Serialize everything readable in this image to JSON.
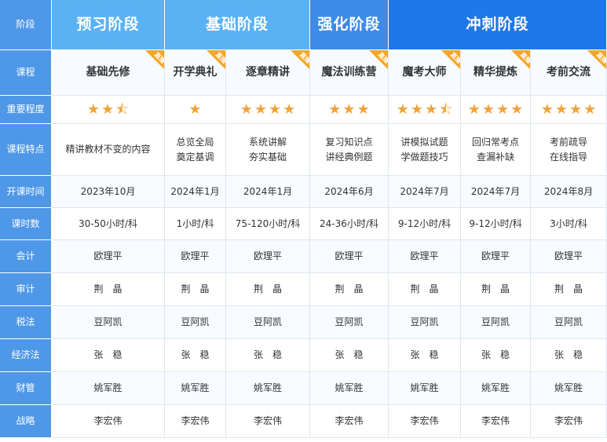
{
  "labels": [
    "阶段",
    "课程",
    "重要程度",
    "课程特点",
    "开课时间",
    "课时数",
    "会计",
    "审计",
    "税法",
    "经济法",
    "财管",
    "战略"
  ],
  "stages": [
    {
      "name": "预习阶段",
      "span": 1,
      "tone": "h-light"
    },
    {
      "name": "基础阶段",
      "span": 2,
      "tone": "h-light"
    },
    {
      "name": "强化阶段",
      "span": 1,
      "tone": "h-mid"
    },
    {
      "name": "冲刺阶段",
      "span": 3,
      "tone": "h-dark"
    }
  ],
  "tag_text": "直播",
  "courses": [
    {
      "name": "基础先修",
      "stars": 2.5,
      "feature": "精讲教材不变的内容",
      "start": "2023年10月",
      "hours": "30-50小时/科",
      "kuaiji": "欧理平",
      "shenji": "荆　晶",
      "shuifa": "豆阿凯",
      "jingjifa": "张　稳",
      "caiguan": "姚军胜",
      "zhanlue": "李宏伟"
    },
    {
      "name": "开学典礼",
      "stars": 1,
      "feature": "总览全局\n奠定基调",
      "start": "2024年1月",
      "hours": "1小时/科",
      "kuaiji": "欧理平",
      "shenji": "荆　晶",
      "shuifa": "豆阿凯",
      "jingjifa": "张　稳",
      "caiguan": "姚军胜",
      "zhanlue": "李宏伟"
    },
    {
      "name": "逐章精讲",
      "stars": 4,
      "feature": "系统讲解\n夯实基础",
      "start": "2024年1月",
      "hours": "75-120小时/科",
      "kuaiji": "欧理平",
      "shenji": "荆　晶",
      "shuifa": "豆阿凯",
      "jingjifa": "张　稳",
      "caiguan": "姚军胜",
      "zhanlue": "李宏伟"
    },
    {
      "name": "魔法训练营",
      "stars": 3,
      "feature": "复习知识点\n讲经典例题",
      "start": "2024年6月",
      "hours": "24-36小时/科",
      "kuaiji": "欧理平",
      "shenji": "荆　晶",
      "shuifa": "豆阿凯",
      "jingjifa": "张　稳",
      "caiguan": "姚军胜",
      "zhanlue": "李宏伟"
    },
    {
      "name": "魔考大师",
      "stars": 3.5,
      "feature": "讲模拟试题\n学做题技巧",
      "start": "2024年7月",
      "hours": "9-12小时/科",
      "kuaiji": "欧理平",
      "shenji": "荆　晶",
      "shuifa": "豆阿凯",
      "jingjifa": "张　稳",
      "caiguan": "姚军胜",
      "zhanlue": "李宏伟"
    },
    {
      "name": "精华提炼",
      "stars": 4,
      "feature": "回归常考点\n查漏补缺",
      "start": "2024年7月",
      "hours": "9-12小时/科",
      "kuaiji": "欧理平",
      "shenji": "荆　晶",
      "shuifa": "豆阿凯",
      "jingjifa": "张　稳",
      "caiguan": "姚军胜",
      "zhanlue": "李宏伟"
    },
    {
      "name": "考前交流",
      "stars": 4,
      "feature": "考前疏导\n在线指导",
      "start": "2024年8月",
      "hours": "3小时/科",
      "kuaiji": "欧理平",
      "shenji": "荆　晶",
      "shuifa": "豆阿凯",
      "jingjifa": "张　稳",
      "caiguan": "姚军胜",
      "zhanlue": "李宏伟"
    }
  ],
  "colors": {
    "label_bg": "#4f98e8",
    "star": "#f3a23a",
    "tag": "#f5a623"
  }
}
